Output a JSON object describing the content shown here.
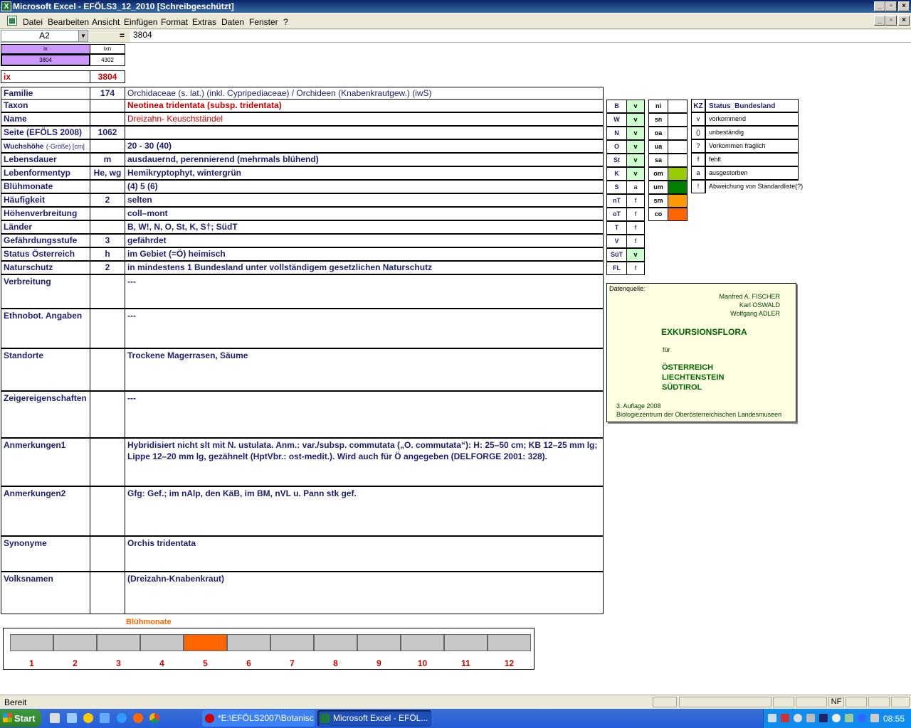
{
  "window": {
    "title": "Microsoft Excel - EFÖLS3_12_2010  [Schreibgeschützt]",
    "app_icon": "excel-icon"
  },
  "menu": [
    "Datei",
    "Bearbeiten",
    "Ansicht",
    "Einfügen",
    "Format",
    "Extras",
    "Daten",
    "Fenster",
    "?"
  ],
  "formula_bar": {
    "name_box": "A2",
    "equals": "=",
    "value": "3804"
  },
  "top_cells": {
    "ix_header": "ix",
    "ixn_header": "ixn",
    "ix_value": "3804",
    "ixn_value": "4302",
    "ix_label": "ix",
    "ix_big": "3804"
  },
  "rows": [
    {
      "label": "Familie",
      "code": "174",
      "value": "Orchidaceae (s. lat.) (inkl. Cypripediaceae)  /  Orchideen (Knabenkrautgew.) (iwS)"
    },
    {
      "label": "Taxon",
      "code": "",
      "value": "Neotinea tridentata (subsp. tridentata)"
    },
    {
      "label": "Name",
      "code": "",
      "value": "Dreizahn- Keuschständel"
    },
    {
      "label": "Seite (EFÖLS 2008)",
      "code": "1062",
      "value": ""
    },
    {
      "label": "Wuchshöhe",
      "label_small": "(-Größe) [cm]",
      "code": "",
      "value": " 20 - 30 (40)"
    },
    {
      "label": "Lebensdauer",
      "code": "m",
      "value": "ausdauernd, perennierend (mehrmals blühend)"
    },
    {
      "label": "Lebenformentyp",
      "code": "He, wg",
      "value": "Hemikryptophyt, wintergrün"
    },
    {
      "label": "Blühmonate",
      "code": "",
      "value": "(4) 5 (6)"
    },
    {
      "label": "Häufigkeit",
      "code": "2",
      "value": "selten"
    },
    {
      "label": "Höhenverbreitung",
      "code": "",
      "value": "coll–mont"
    },
    {
      "label": "Länder",
      "code": "",
      "value": "B, W!, N, O, St, K, S†; SüdT"
    },
    {
      "label": "Gefährdungsstufe",
      "code": "3",
      "value": "gefährdet"
    },
    {
      "label": "Status Österreich",
      "code": "h",
      "value": "im Gebiet (=Ö) heimisch"
    },
    {
      "label": "Naturschutz",
      "code": "2",
      "value": "in mindestens 1 Bundesland unter vollständigem gesetzlichen Naturschutz"
    },
    {
      "label": "Verbreitung",
      "code": "",
      "value": " ---"
    },
    {
      "label": "Ethnobot. Angaben",
      "code": "",
      "value": "---"
    },
    {
      "label": "Standorte",
      "code": "",
      "value": "Trockene Magerrasen, Säume"
    },
    {
      "label": "Zeigereigenschaften",
      "code": "",
      "value": "---"
    },
    {
      "label": "Anmerkungen1",
      "code": "",
      "value": "Hybridisiert nicht slt mit N. ustulata. Anm.: var./subsp. commutata („O. commutata“): H: 25–50 cm; KB 12–25 mm lg;",
      "value2": "Lippe 12–20 mm lg, gezähnelt (HptVbr.: ost-medit.). Wird auch für Ö angegeben (DELFORGE 2001: 328)."
    },
    {
      "label": "Anmerkungen2",
      "code": "",
      "value": "Gfg: Gef.; im nAlp, den KäB, im BM, nVL u. Pann stk gef."
    },
    {
      "label": "Synonyme",
      "code": "",
      "value": "Orchis tridentata"
    },
    {
      "label": "Volksnamen",
      "code": "",
      "value": "(Dreizahn-Knabenkraut)"
    }
  ],
  "states": [
    {
      "code": "B",
      "status": "v"
    },
    {
      "code": "W",
      "status": "v"
    },
    {
      "code": "N",
      "status": "v"
    },
    {
      "code": "O",
      "status": "v"
    },
    {
      "code": "St",
      "status": "v"
    },
    {
      "code": "K",
      "status": "v"
    },
    {
      "code": "S",
      "status": "a"
    },
    {
      "code": "nT",
      "status": "f"
    },
    {
      "code": "oT",
      "status": "f"
    },
    {
      "code": "T",
      "status": "f"
    },
    {
      "code": "V",
      "status": "f"
    },
    {
      "code": "SüT",
      "status": "v"
    },
    {
      "code": "FL",
      "status": "f"
    }
  ],
  "altitude": [
    {
      "code": "ni",
      "color": ""
    },
    {
      "code": "sn",
      "color": ""
    },
    {
      "code": "oa",
      "color": ""
    },
    {
      "code": "ua",
      "color": ""
    },
    {
      "code": "sa",
      "color": ""
    },
    {
      "code": "om",
      "color": "#99cc00"
    },
    {
      "code": "um",
      "color": "#008000"
    },
    {
      "code": "sm",
      "color": "#ff9900"
    },
    {
      "code": "co",
      "color": "#ff6600"
    }
  ],
  "legend": {
    "header_kz": "KZ",
    "header_status": "Status_Bundesland",
    "items": [
      {
        "kz": "v",
        "text": "vorkommend"
      },
      {
        "kz": "()",
        "text": "unbeständig"
      },
      {
        "kz": "?",
        "text": "Vorkommen fraglich"
      },
      {
        "kz": "f",
        "text": "fehlt"
      },
      {
        "kz": "a",
        "text": "ausgestorben"
      },
      {
        "kz": "!",
        "text": "Abweichung von Standardliste(?)"
      }
    ]
  },
  "source_box": {
    "label": "Datenquelle:",
    "authors": [
      "Manfred A. FISCHER",
      "Karl OSWALD",
      "Wolfgang ADLER"
    ],
    "title": "EXKURSIONSFLORA",
    "fuer": "für",
    "countries": [
      "ÖSTERREICH",
      "LIECHTENSTEIN",
      "SÜDTIROL"
    ],
    "edition": "3. Auflage 2008",
    "publisher": "Biologiezentrum der Oberösterreichischen Landesmuseen"
  },
  "bloom_chart": {
    "title": "Blühmonate",
    "months": [
      "1",
      "2",
      "3",
      "4",
      "5",
      "6",
      "7",
      "8",
      "9",
      "10",
      "11",
      "12"
    ],
    "active": [
      5
    ],
    "active_color": "#ff6600"
  },
  "status_bar": {
    "text": "Bereit",
    "nf": "NF"
  },
  "taskbar": {
    "start": "Start",
    "tasks": [
      "*E:\\EFÖLS2007\\Botanisc...",
      "Microsoft Excel - EFÖL..."
    ],
    "time": "08:55"
  }
}
